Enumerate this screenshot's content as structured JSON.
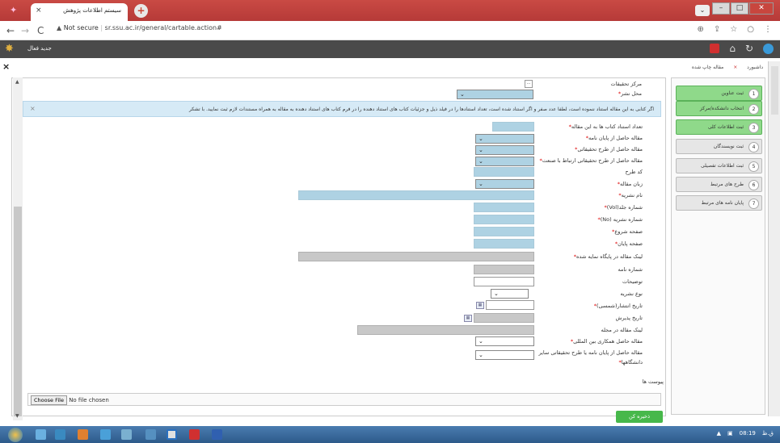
{
  "browser": {
    "tab_title": "سیستم اطلاعات پژوهش",
    "tab_close": "×",
    "new_tab": "+",
    "not_secure": "Not secure",
    "url": "sr.ssu.ac.ir/general/cartable.action#"
  },
  "app_header": {
    "label": "جدید فعال"
  },
  "close_label": "×",
  "sidebar": {
    "tab_dashboard": "داشبورد",
    "tab_close": "×",
    "tab_article": "مقاله چاپ شده",
    "steps": [
      {
        "num": "1",
        "label": "ثبت عناوین",
        "active": true
      },
      {
        "num": "2",
        "label": "انتخاب دانشکده/مرکز",
        "active": true
      },
      {
        "num": "3",
        "label": "ثبت اطلاعات کلی",
        "active": true
      },
      {
        "num": "4",
        "label": "ثبت نویسندگان",
        "active": false
      },
      {
        "num": "5",
        "label": "ثبت اطلاعات تفصیلی",
        "active": false
      },
      {
        "num": "6",
        "label": "طرح های مرتبط",
        "active": false
      },
      {
        "num": "7",
        "label": "پایان نامه های مرتبط",
        "active": false
      }
    ]
  },
  "form": {
    "research_center": "مرکز تحقیقات",
    "publish_place": "محل نشر",
    "info_text": "اگر کتابی به این مقاله استناد ننموده است، لطفا عدد صفر و اگر استناد شده است، تعداد استنادها را در فیلد ذیل و جزئیات کتاب های استناد دهنده را در فرم کتاب های استناد دهنده به مقاله به همراه مستندات لازم ثبت نمایید. با تشکر",
    "info_close": "×",
    "labels": {
      "book_citations": "تعداد استناد کتاب ها به این مقاله",
      "from_thesis": "مقاله حاصل از پایان نامه",
      "from_research": "مقاله حاصل از طرح تحقیقاتی",
      "from_industry": "مقاله حاصل از طرح تحقیقاتی ارتباط با صنعت",
      "project_code": "کد طرح",
      "language": "زبان مقاله",
      "journal_name": "نام نشریه",
      "volume": "شماره جلد(Vol)",
      "issue": "شماره نشریه (No)",
      "start_page": "صفحه شروع",
      "end_page": "صفحه پایان",
      "index_link": "لینک مقاله در پایگاه نمایه شده",
      "letter_no": "شماره نامه",
      "description": "توضیحات",
      "journal_type": "نوع نشریه",
      "publish_date": "تاریخ انتشار(شمسی)",
      "accept_date": "تاریخ پذیرش",
      "journal_link": "لینک مقاله در مجله",
      "international": "مقاله حاصل همکاری بین المللی",
      "other_univ_1": "مقاله حاصل از پایان نامه یا طرح تحقیقاتی سایر",
      "other_univ_2": "دانشگاهها",
      "attachments": "پیوست ها"
    },
    "choose_file": "Choose File",
    "no_file": "No file chosen",
    "save": "ذخیره کن"
  },
  "taskbar": {
    "lang": "ق.ظ",
    "time": "08:19"
  }
}
